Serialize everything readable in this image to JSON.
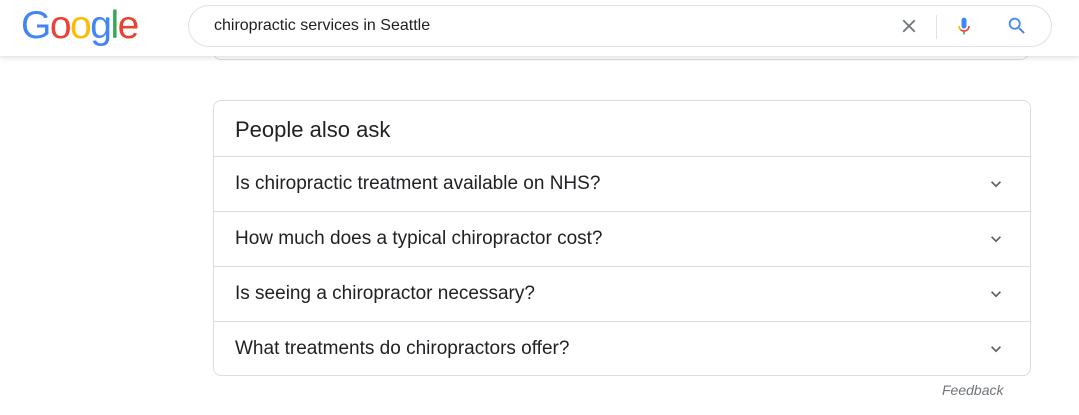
{
  "header": {
    "logo": {
      "letters": [
        "G",
        "o",
        "o",
        "g",
        "l",
        "e"
      ],
      "colors": [
        "#4285F4",
        "#EA4335",
        "#FBBC05",
        "#4285F4",
        "#34A853",
        "#EA4335"
      ]
    },
    "search": {
      "value": "chiropractic services in Seattle",
      "clear_icon": "close-icon",
      "mic_icon": "microphone-icon",
      "search_icon": "search-icon"
    }
  },
  "people_also_ask": {
    "title": "People also ask",
    "questions": [
      "Is chiropractic treatment available on NHS?",
      "How much does a typical chiropractor cost?",
      "Is seeing a chiropractor necessary?",
      "What treatments do chiropractors offer?"
    ],
    "expand_icon": "chevron-down-icon"
  },
  "footer": {
    "feedback_label": "Feedback"
  },
  "colors": {
    "border": "#dadce0",
    "text": "#202124",
    "muted": "#70757a",
    "accent_blue": "#4285F4"
  }
}
